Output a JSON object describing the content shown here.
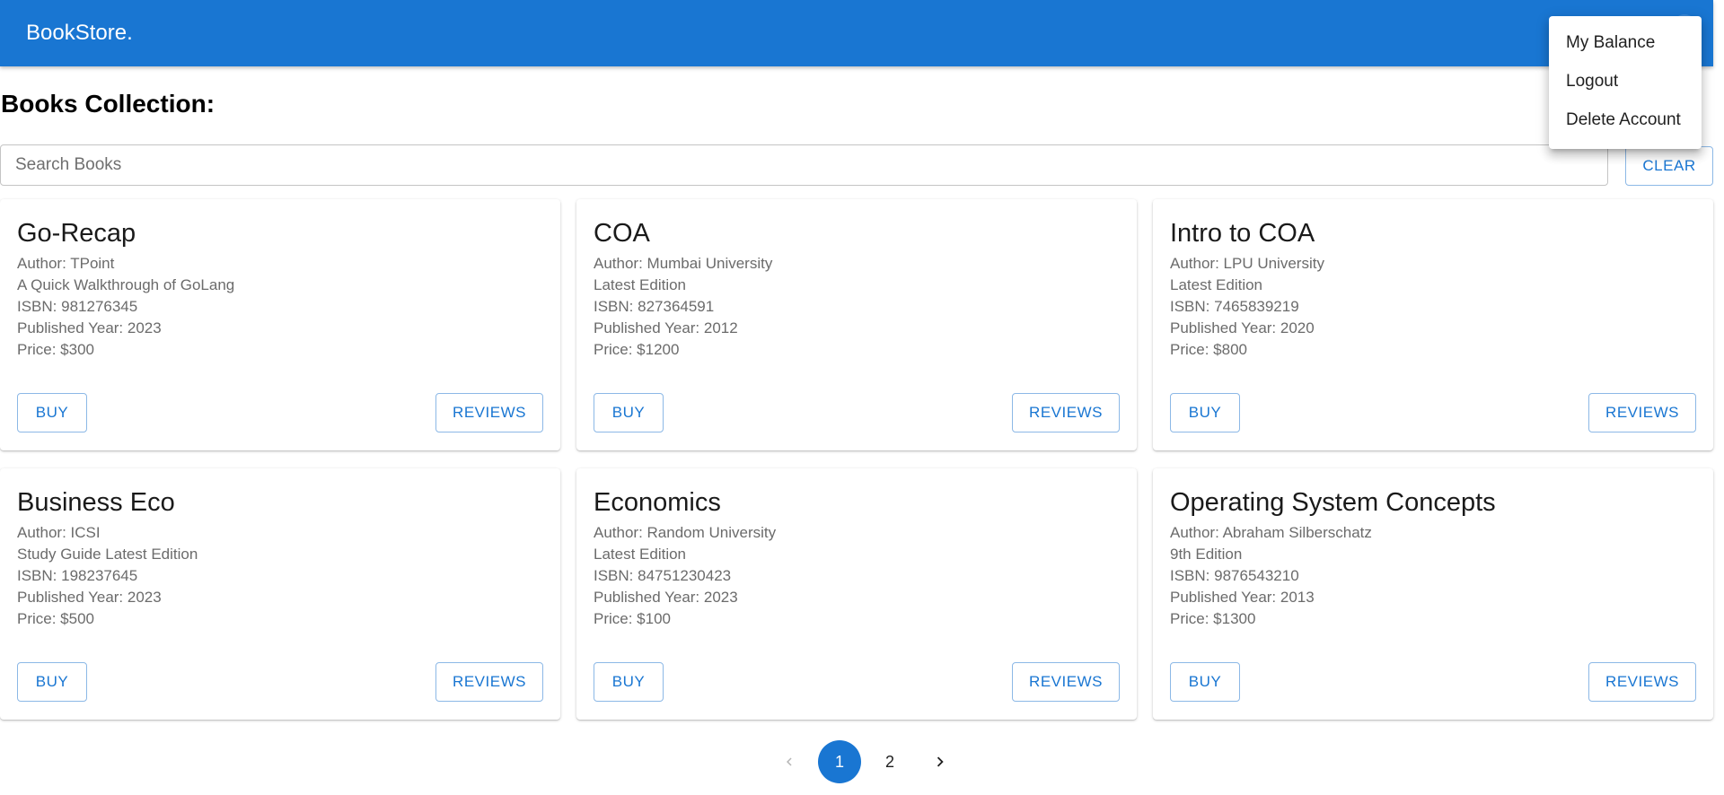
{
  "header": {
    "brand": "BookStore."
  },
  "page": {
    "title": "Books Collection:"
  },
  "search": {
    "placeholder": "Search Books",
    "value": "",
    "clear_label": "CLEAR"
  },
  "books": [
    {
      "title": "Go-Recap",
      "author": "Author: TPoint",
      "description": "A Quick Walkthrough of GoLang",
      "isbn": "ISBN: 981276345",
      "year": "Published Year: 2023",
      "price": "Price: $300",
      "buy_label": "BUY",
      "reviews_label": "REVIEWS"
    },
    {
      "title": "COA",
      "author": "Author: Mumbai University",
      "description": "Latest Edition",
      "isbn": "ISBN: 827364591",
      "year": "Published Year: 2012",
      "price": "Price: $1200",
      "buy_label": "BUY",
      "reviews_label": "REVIEWS"
    },
    {
      "title": "Intro to COA",
      "author": "Author: LPU University",
      "description": "Latest Edition",
      "isbn": "ISBN: 7465839219",
      "year": "Published Year: 2020",
      "price": "Price: $800",
      "buy_label": "BUY",
      "reviews_label": "REVIEWS"
    },
    {
      "title": "Business Eco",
      "author": "Author: ICSI",
      "description": "Study Guide Latest Edition",
      "isbn": "ISBN: 198237645",
      "year": "Published Year: 2023",
      "price": "Price: $500",
      "buy_label": "BUY",
      "reviews_label": "REVIEWS"
    },
    {
      "title": "Economics",
      "author": "Author: Random University",
      "description": "Latest Edition",
      "isbn": "ISBN: 84751230423",
      "year": "Published Year: 2023",
      "price": "Price: $100",
      "buy_label": "BUY",
      "reviews_label": "REVIEWS"
    },
    {
      "title": "Operating System Concepts",
      "author": "Author: Abraham Silberschatz",
      "description": "9th Edition",
      "isbn": "ISBN: 9876543210",
      "year": "Published Year: 2013",
      "price": "Price: $1300",
      "buy_label": "BUY",
      "reviews_label": "REVIEWS"
    }
  ],
  "pagination": {
    "prev_icon": "chevron-left-icon",
    "next_icon": "chevron-right-icon",
    "pages": [
      "1",
      "2"
    ],
    "current_page": "1"
  },
  "account_menu": {
    "items": [
      "My Balance",
      "Logout",
      "Delete Account"
    ]
  },
  "colors": {
    "primary": "#1976d2",
    "card_text_secondary": "#6b6b6b"
  }
}
